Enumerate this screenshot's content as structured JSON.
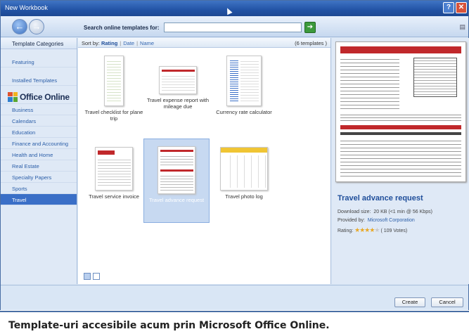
{
  "window": {
    "title": "New Workbook",
    "help_btn": "?",
    "close_btn": "✕"
  },
  "toolbar": {
    "back_icon": "arrow-left-icon",
    "forward_icon": "arrow-right-icon",
    "search_label": "Search online templates for:",
    "search_value": "",
    "go_icon": "go-arrow-icon",
    "go_btn": "➔",
    "back_btn": "←",
    "fwd_btn": "→"
  },
  "sidebar": {
    "header": "Template Categories",
    "top_items": [
      "Featuring",
      "Installed Templates"
    ],
    "brand": "Office Online",
    "brand_prefix": "Microsoft",
    "items": [
      "Business",
      "Calendars",
      "Education",
      "Finance and Accounting",
      "Health and Home",
      "Real Estate",
      "Specialty Papers",
      "Sports",
      "Travel"
    ],
    "selected": "Travel"
  },
  "sortbar": {
    "label": "Sort by:",
    "options": [
      "Rating",
      "Date",
      "Name"
    ],
    "selected": "Rating",
    "count": "(6 templates )"
  },
  "templates": [
    {
      "name": "Travel checklist for plane trip"
    },
    {
      "name": "Travel expense report with mileage due"
    },
    {
      "name": "Currency rate calculator"
    },
    {
      "name": "Travel service invoice"
    },
    {
      "name": "Travel advance request"
    },
    {
      "name": "Travel photo log"
    }
  ],
  "selected_template": "Travel advance request",
  "preview": {
    "title": "Travel advance request",
    "download_label": "Download size:",
    "download_value": "20 KB (<1 min @ 56 Kbps)",
    "provided_label": "Provided by:",
    "provided_value": "Microsoft Corporation",
    "rating_label": "Rating:",
    "rating_stars": 4,
    "rating_votes": "( 109 Votes)"
  },
  "buttons": {
    "create": "Create",
    "cancel": "Cancel"
  },
  "caption": "Template-uri accesibile acum prin Microsoft Office Online.",
  "colors": {
    "accent": "#3a6fc7",
    "title_bar": "#2253a5",
    "brand_red": "#c0282b"
  }
}
